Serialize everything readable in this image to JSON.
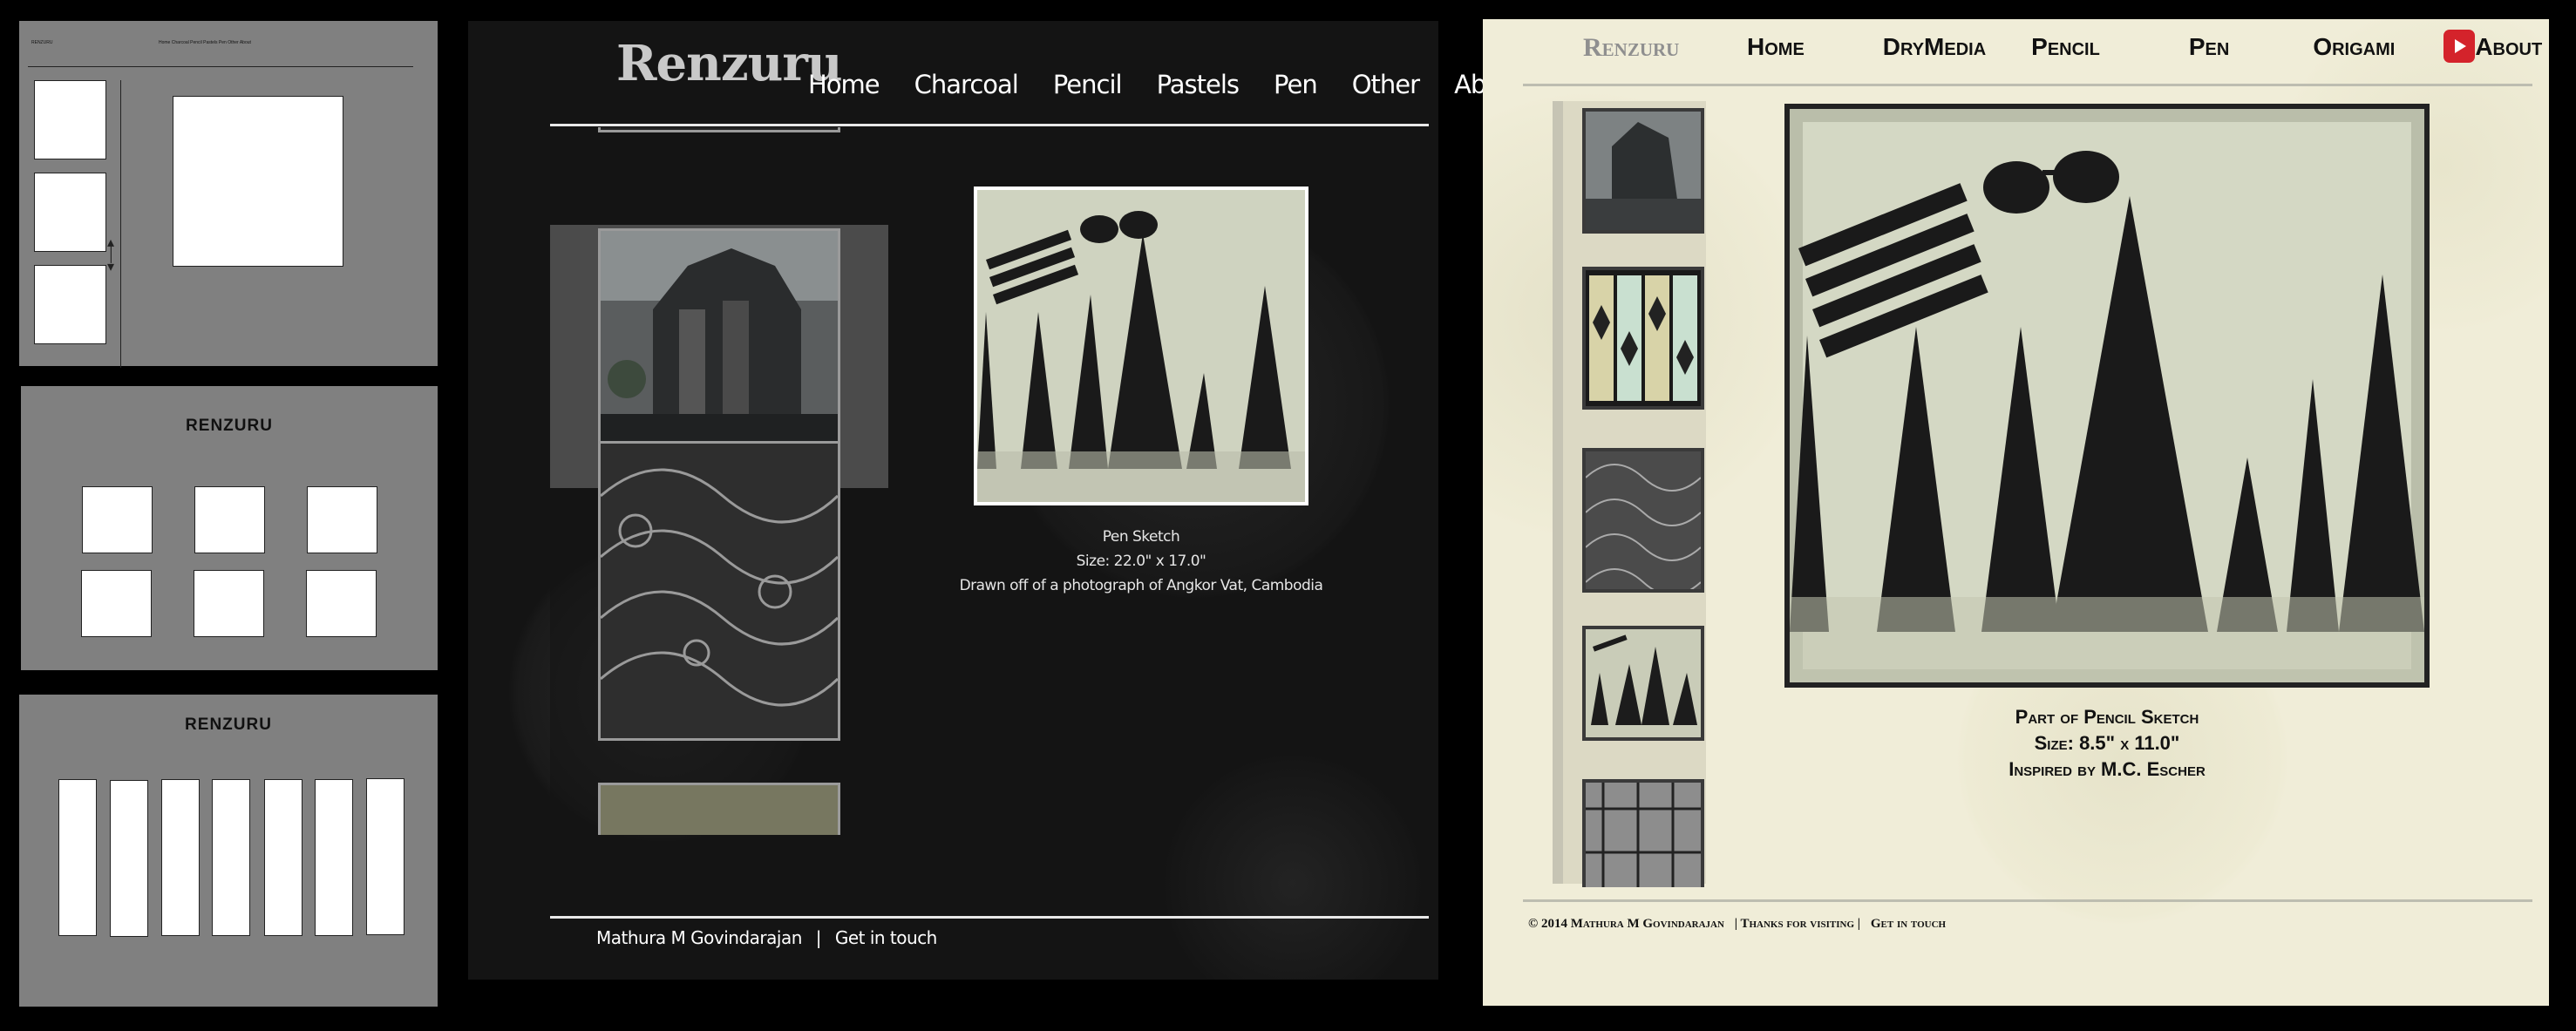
{
  "wireframe_1": {
    "title": "RENZURU",
    "nav": "Home   Charcoal   Pencil   Pastels   Pen   Other   About"
  },
  "wireframe_2": {
    "title": "RENZURU"
  },
  "wireframe_3": {
    "title": "RENZURU"
  },
  "dark_site": {
    "logo": "Renzuru",
    "nav": [
      "Home",
      "Charcoal",
      "Pencil",
      "Pastels",
      "Pen",
      "Other",
      "About"
    ],
    "caption": {
      "title": "Pen Sketch",
      "size": "Size: 22.0\" x 17.0\"",
      "note": "Drawn off of a photograph of Angkor Vat, Cambodia"
    },
    "footer": {
      "name": "Mathura M Govindarajan",
      "separator": "|",
      "contact": "Get in touch"
    }
  },
  "cream_site": {
    "logo": "Renzuru",
    "nav": [
      "Home",
      "DryMedia",
      "Pencil",
      "Pen",
      "Origami",
      "About"
    ],
    "youtube_icon": "play-icon",
    "caption": {
      "title": "Part of Pencil Sketch",
      "size": "Size: 8.5\" x 11.0\"",
      "note": "Inspired by M.C. Escher"
    },
    "footer": {
      "copyright": "© 2014 Mathura M Govindarajan",
      "thanks": "| Thanks for visiting |",
      "contact": "Get in touch"
    }
  },
  "colors": {
    "accent_youtube": "#d4232b",
    "dark_bg": "#141414",
    "cream_bg": "#f0edd8",
    "wireframe_bg": "#808080"
  }
}
